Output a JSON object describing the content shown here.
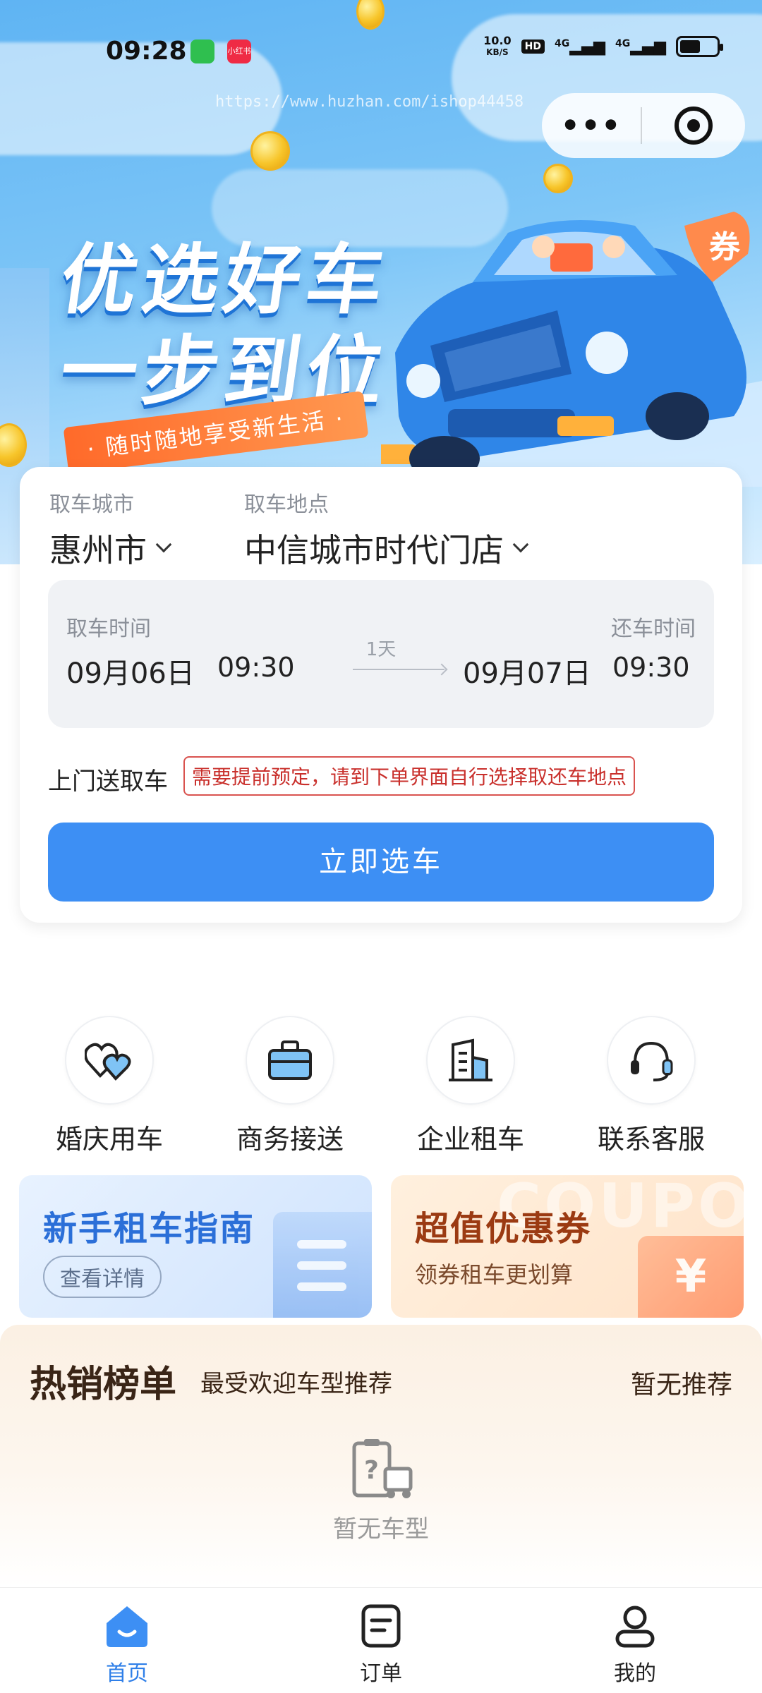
{
  "status_bar": {
    "time": "09:28",
    "net_speed_value": "10.0",
    "net_speed_unit": "KB/S",
    "hd": "HD",
    "signal1": "4G",
    "signal2": "4G",
    "notification_b_text": "小红书"
  },
  "watermark": "https://www.huzhan.com/ishop44458",
  "hero": {
    "slogan_line1": "优选好车",
    "slogan_line2": "一步到位",
    "slogan_sub": "· 随时随地享受新生活 ·",
    "car_flag": "券"
  },
  "booking": {
    "pickup_city_label": "取车城市",
    "pickup_city_value": "惠州市",
    "pickup_location_label": "取车地点",
    "pickup_location_value": "中信城市时代门店",
    "pickup_time_label": "取车时间",
    "pickup_date": "09月06日",
    "pickup_time": "09:30",
    "duration": "1天",
    "return_time_label": "还车时间",
    "return_date": "09月07日",
    "return_time": "09:30",
    "door_service_label": "上门送取车",
    "door_service_tip": "需要提前预定，请到下单界面自行选择取还车地点",
    "submit_label": "立即选车"
  },
  "services": [
    {
      "label": "婚庆用车",
      "icon": "hearts-icon"
    },
    {
      "label": "商务接送",
      "icon": "briefcase-icon"
    },
    {
      "label": "企业租车",
      "icon": "building-icon"
    },
    {
      "label": "联系客服",
      "icon": "headset-icon"
    }
  ],
  "promos": {
    "guide_title": "新手租车指南",
    "guide_button": "查看详情",
    "coupon_title": "超值优惠券",
    "coupon_sub": "领券租车更划算",
    "coupon_watermark": "COUPON",
    "coupon_symbol": "¥"
  },
  "hot_list": {
    "title": "热销榜单",
    "subtitle": "最受欢迎车型推荐",
    "more": "暂无推荐",
    "empty_text": "暂无车型"
  },
  "tabbar": [
    {
      "label": "首页",
      "icon": "home-icon",
      "active": true
    },
    {
      "label": "订单",
      "icon": "order-icon",
      "active": false
    },
    {
      "label": "我的",
      "icon": "profile-icon",
      "active": false
    }
  ],
  "colors": {
    "accent": "#3d8ff4",
    "tab_active": "#2f7fe8",
    "warning": "#c9302c"
  }
}
